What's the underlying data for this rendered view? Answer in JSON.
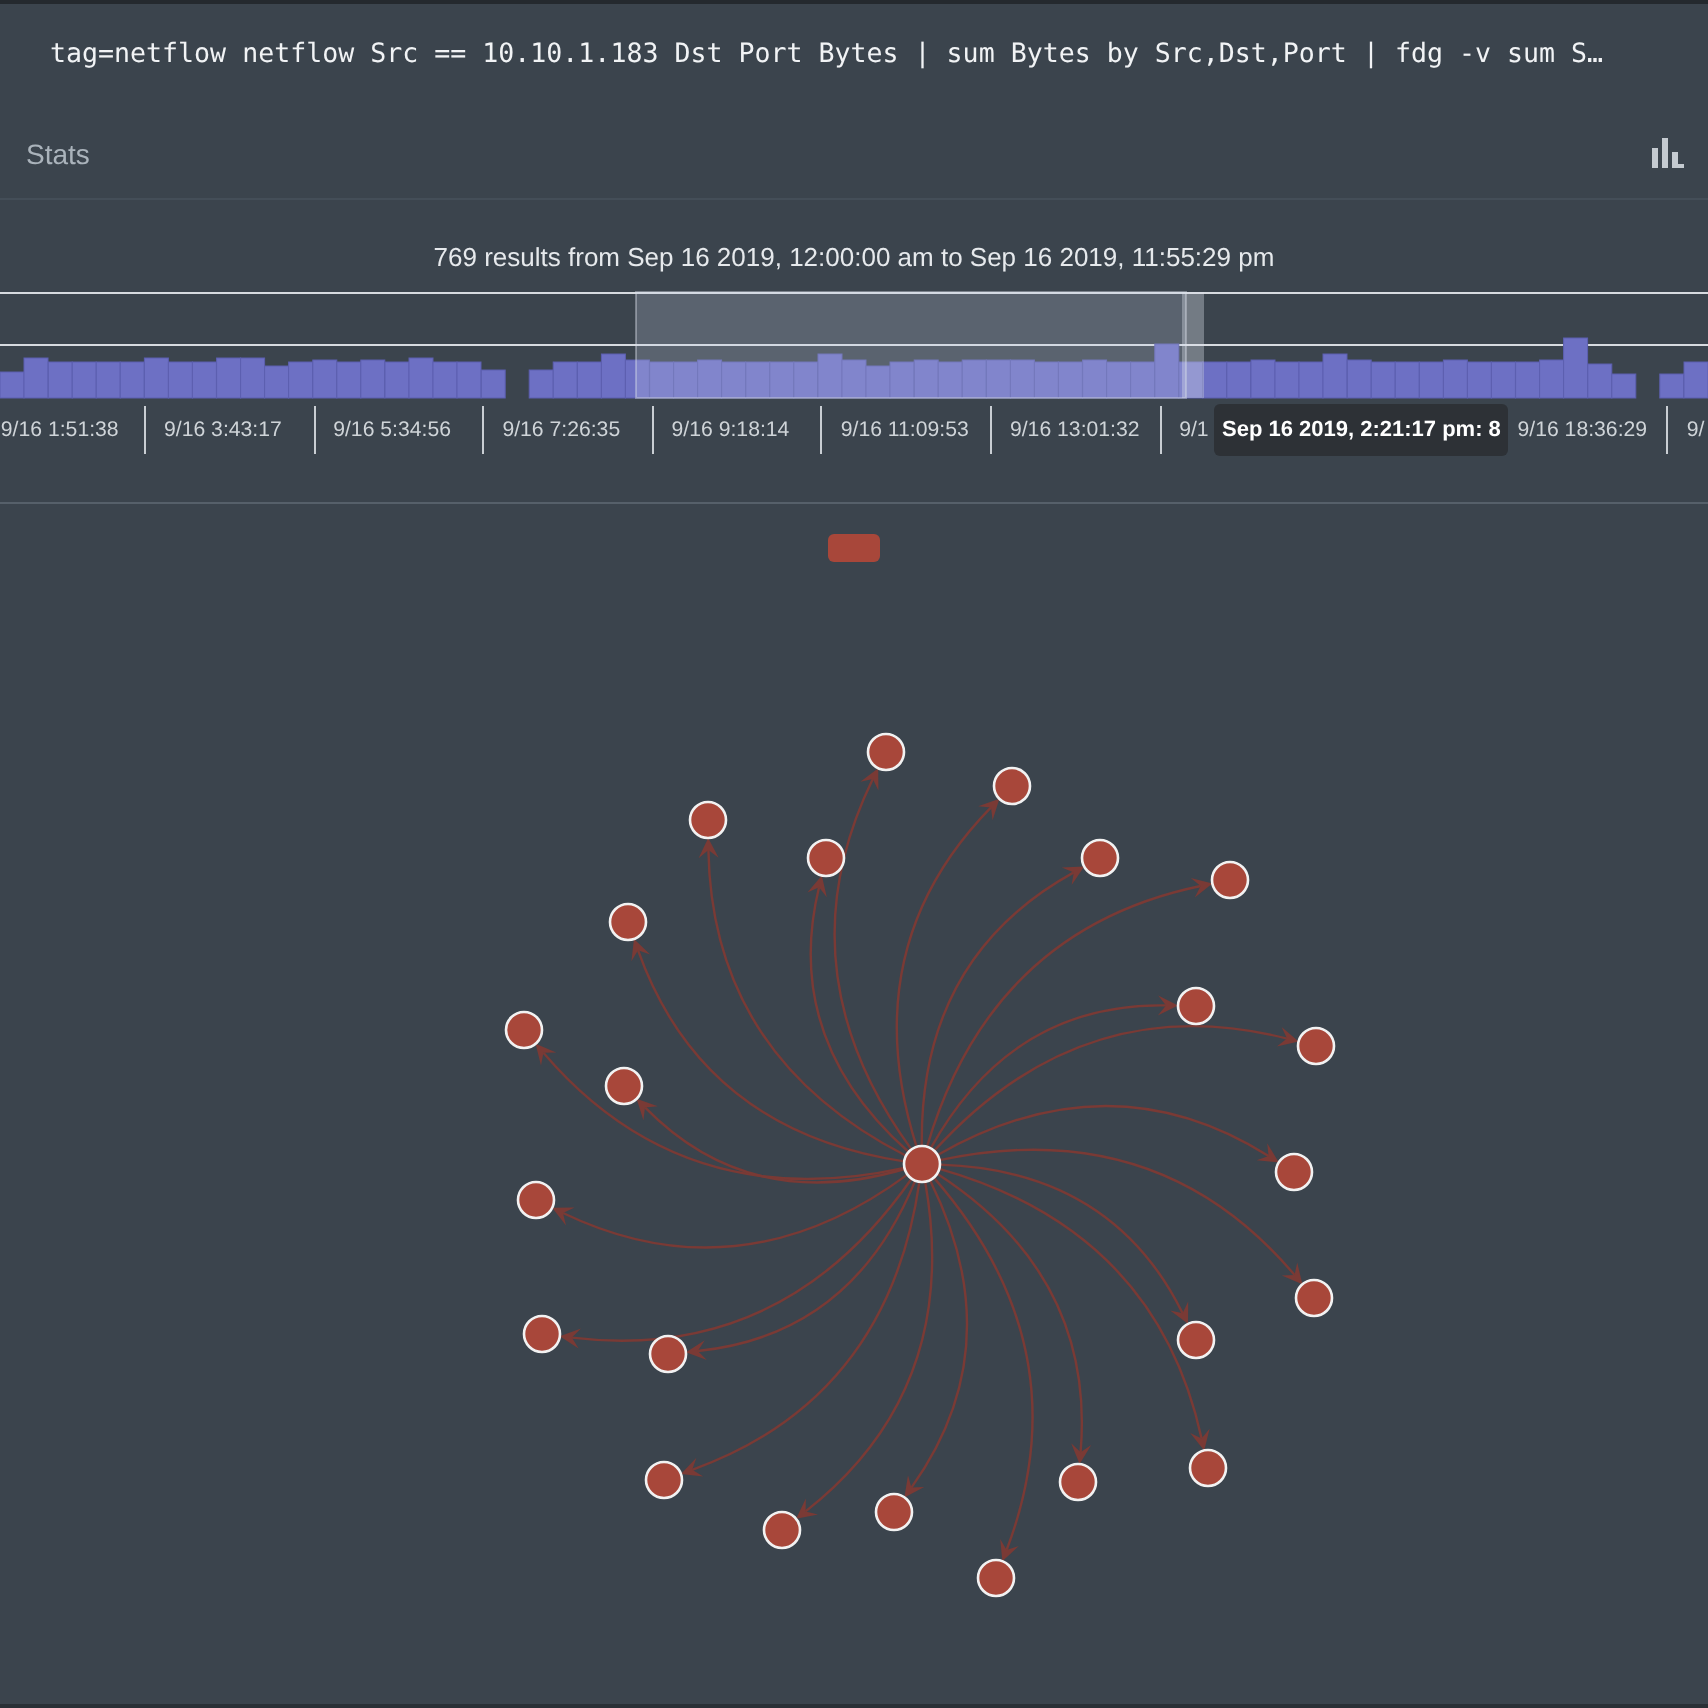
{
  "query": {
    "text": "tag=netflow netflow Src == 10.10.1.183 Dst Port Bytes | sum Bytes by Src,Dst,Port | fdg -v sum S…"
  },
  "stats_panel": {
    "title": "Stats"
  },
  "summary": "769 results from Sep 16 2019, 12:00:00 am to Sep 16 2019, 11:55:29 pm",
  "timeline": {
    "axis_labels": [
      "9/16 1:51:38",
      "9/16 3:43:17",
      "9/16 5:34:56",
      "9/16 7:26:35",
      "9/16 9:18:14",
      "9/16 11:09:53",
      "9/16 13:01:32",
      "9/1",
      "9/16 18:36:29",
      "9/"
    ],
    "tooltip": "Sep 16 2019, 2:21:17 pm: 8"
  },
  "graph": {
    "legend": [
      {
        "color": "#a8473a"
      }
    ]
  }
}
